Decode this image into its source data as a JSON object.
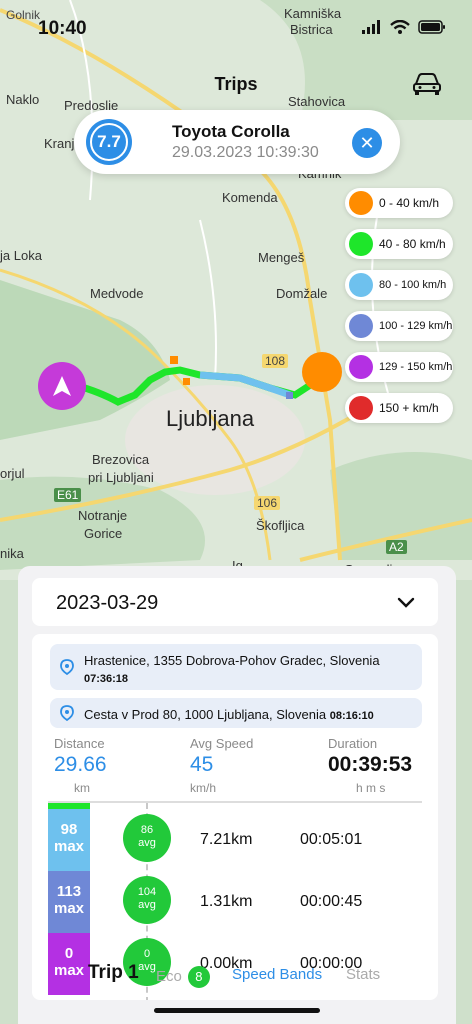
{
  "status": {
    "time": "10:40"
  },
  "header": {
    "title": "Trips"
  },
  "map_labels": {
    "golnik": "Golnik",
    "kamniska": "Kamniška",
    "bistrica": "Bistrica",
    "naklo": "Naklo",
    "predoslje": "Predoslje",
    "stahovica": "Stahovica",
    "kranj": "Kranj",
    "kamnik": "Kamnik",
    "komenda": "Komenda",
    "skofja_loka": "ja Loka",
    "mengen": "Mengeš",
    "medvode": "Medvode",
    "domzale": "Domžale",
    "road108": "108",
    "ljubljana": "Ljubljana",
    "brezovica": "Brezovica",
    "pri_ljubljani": "pri Ljubljani",
    "vrhnika": "orjul",
    "e61": "E61",
    "road106": "106",
    "notranje": "Notranje",
    "gorice": "Gorice",
    "skofljica": "Škofljica",
    "nika": "nika",
    "a2": "A2",
    "ig": "Ig",
    "grosuplje": "Grosuplje"
  },
  "vehicle": {
    "score": "7.7",
    "name": "Toyota Corolla",
    "date": "29.03.2023 10:39:30"
  },
  "legend": [
    {
      "label": "0 - 40 km/h",
      "color": "#ff8c00"
    },
    {
      "label": "40 - 80 km/h",
      "color": "#1ee62a"
    },
    {
      "label": "80 - 100 km/h",
      "color": "#6ec1ee"
    },
    {
      "label": "100 - 129 km/h",
      "color": "#6f88d6"
    },
    {
      "label": "129 - 150 km/h",
      "color": "#b430e3"
    },
    {
      "label": "150 + km/h",
      "color": "#e02b2b"
    }
  ],
  "trip": {
    "date": "2023-03-29",
    "start_address": "Hrastenice, 1355 Dobrova-Pohov Gradec, Slovenia",
    "start_time": "07:36:18",
    "end_address": "Cesta v Prod 80, 1000 Ljubljana, Slovenia",
    "end_time": "08:16:10",
    "distance_label": "Distance",
    "distance": "29.66",
    "distance_unit": "km",
    "avg_speed_label": "Avg Speed",
    "avg_speed": "45",
    "avg_speed_unit": "km/h",
    "duration_label": "Duration",
    "duration": "00:39:53",
    "duration_unit": "h m s"
  },
  "bands": [
    {
      "max": "98",
      "max_label": "max",
      "avg": "86",
      "avg_label": "avg",
      "distance": "7.21km",
      "time": "00:05:01",
      "color": "#6ec1ee"
    },
    {
      "max": "113",
      "max_label": "max",
      "avg": "104",
      "avg_label": "avg",
      "distance": "1.31km",
      "time": "00:00:45",
      "color": "#6f88d6"
    },
    {
      "max": "0",
      "max_label": "max",
      "avg": "0",
      "avg_label": "avg",
      "distance": "0.00km",
      "time": "00:00:00",
      "color": "#b430e3"
    }
  ],
  "tabs": {
    "trip": "Trip 1",
    "eco": "Eco",
    "eco_count": "8",
    "speed_bands": "Speed Bands",
    "stats": "Stats"
  }
}
